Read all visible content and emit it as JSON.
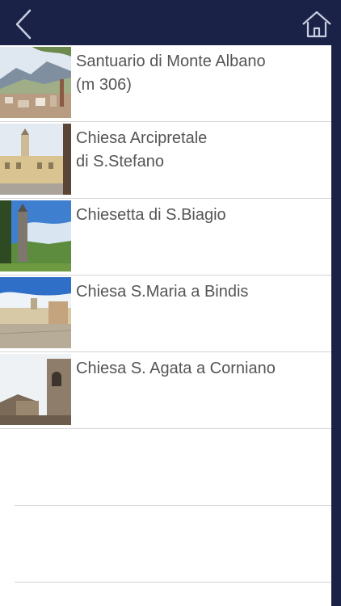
{
  "header": {
    "back_icon": "chevron-left-icon",
    "home_icon": "home-icon",
    "background": "#1a2347"
  },
  "items": [
    {
      "title": "Santuario di Monte Albano\n(m 306)",
      "thumb": "mountain-village-photo"
    },
    {
      "title": "Chiesa Arcipretale\ndi S.Stefano",
      "thumb": "church-square-photo"
    },
    {
      "title": "Chiesetta di S.Biagio",
      "thumb": "bell-tower-meadow-photo"
    },
    {
      "title": "Chiesa S.Maria a Bindis",
      "thumb": "piazza-church-photo"
    },
    {
      "title": "Chiesa S. Agata a Corniano",
      "thumb": "stone-tower-photo"
    }
  ]
}
